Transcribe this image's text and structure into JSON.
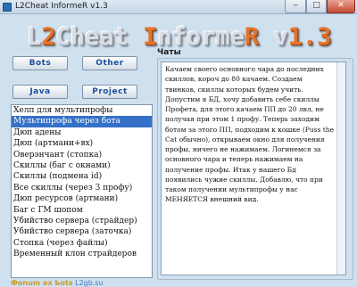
{
  "window": {
    "title": "L2Cheat InformeR v1.3",
    "minimize_glyph": "‒",
    "maximize_glyph": "□",
    "close_glyph": "✕"
  },
  "banner": {
    "part1": "L",
    "part2": "2",
    "part3": "Cheat ",
    "part4": "I",
    "part5": "nforme",
    "part6": "R",
    "part7": " v",
    "part8": "1.3"
  },
  "buttons": {
    "bots": "Bots",
    "other": "Other",
    "java": "Java",
    "project": "Project"
  },
  "list": {
    "items": [
      "Хелп для мультипрофы",
      "Мультипрофа через бота",
      "Дюп адены",
      "Дюп (артмани+вх)",
      "Оверэнчант (стопка)",
      "Скиллы (баг с окнами)",
      "Скиллы (подмена id)",
      "Все скиллы (через 3 профу)",
      "Дюп ресурсов (артмани)",
      "Баг с ГМ шопом",
      "Убийство сервера (страйдер)",
      "Убийство сервера (заточка)",
      "Стопка (через файлы)",
      "Временный клон страйдеров"
    ],
    "selected_index": 1
  },
  "chat": {
    "label": "Чаты",
    "text": "Качаем своего основного чара до последних скиллов, короч до 80 качаем. Создаем твинков, скиллы которых будем учить. Допустим я БД, хочу добавить себе скиллы Профета, для этого качаем ПП до 20 лвл, не получая при этом 1 профу. Теперь заходим ботом за этого ПП, подходим к кошке (Puss the Cat обычно), открываем окно для получения профы, ничего не нажимаем. Логинемся за основного чара и теперь нажимаем на получение профы. Итак у нашего Бд появились чужие скиллы. Добавлю, что при таком получении мультипрофы у нас МЕНЯЕТСЯ внешний вид."
  },
  "footer": {
    "part1": "Фоnum ox Ьоts",
    "part2": "L2gb.su"
  }
}
